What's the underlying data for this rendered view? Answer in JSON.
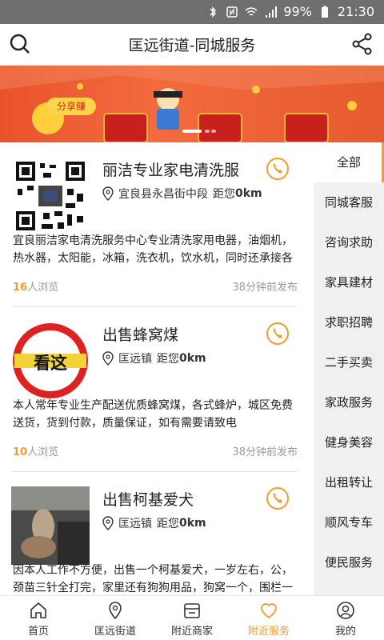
{
  "status_bar": {
    "battery": "99%",
    "time": "21:30"
  },
  "header": {
    "title": "匡远街道-同城服务"
  },
  "banner": {
    "tag": "分享赚"
  },
  "listings": [
    {
      "title": "丽洁专业家电清洗服",
      "location": "宜良县永昌街中段",
      "distance_label": "距您",
      "distance": "0km",
      "description": "宜良丽洁家电清洗服务中心专业清洗家用电器，油烟机，热水器，太阳能，冰箱，洗衣机，饮水机，同时还承接各",
      "views": "16",
      "views_suffix": "人浏览",
      "time": "38分钟前发布"
    },
    {
      "title": "出售蜂窝煤",
      "location": "匡远镇",
      "distance_label": "距您",
      "distance": "0km",
      "description": "本人常年专业生产配送优质蜂窝煤，各式蜂炉，城区免费送货，货到付款，质量保证，如有需要请致电",
      "views": "10",
      "views_suffix": "人浏览",
      "time": "38分钟前发布",
      "image_text": "看这"
    },
    {
      "title": "出售柯基爱犬",
      "location": "匡远镇",
      "distance_label": "距您",
      "distance": "0km",
      "description": "因本人工作不方便，出售一个柯基爱犬，一岁左右，公，颈苗三针全打完，家里还有狗狗用品，狗窝一个，围栏一"
    }
  ],
  "sidebar": {
    "items": [
      "全部",
      "同城客服",
      "咨询求助",
      "家具建材",
      "求职招聘",
      "二手买卖",
      "家政服务",
      "健身美容",
      "出租转让",
      "顺风专车",
      "便民服务"
    ],
    "active": "全部"
  },
  "tabs": [
    {
      "label": "首页",
      "icon": "home-icon"
    },
    {
      "label": "匡远街道",
      "icon": "location-icon"
    },
    {
      "label": "附近商家",
      "icon": "store-icon"
    },
    {
      "label": "附近服务",
      "icon": "heart-icon"
    },
    {
      "label": "我的",
      "icon": "user-icon"
    }
  ],
  "colors": {
    "accent": "#f39b2b",
    "banner": "#e8532b",
    "status_bar": "#6e6e6e"
  }
}
